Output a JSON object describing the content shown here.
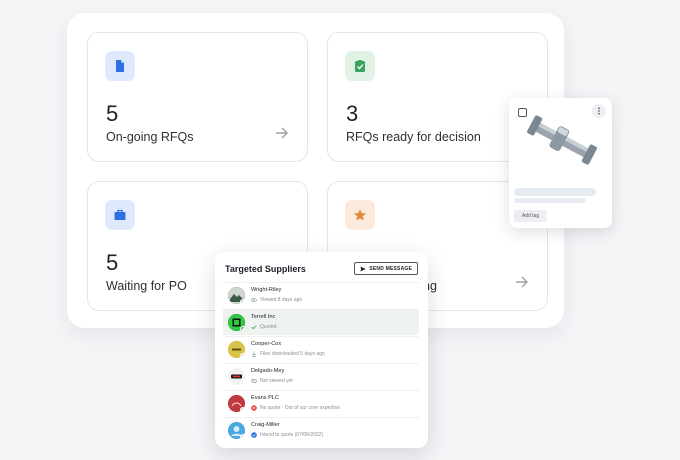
{
  "cards": [
    {
      "count": "5",
      "label": "On-going RFQs",
      "icon": "document-icon",
      "icon_color": "#2f6fe4",
      "icon_bg": "#dfe9fb"
    },
    {
      "count": "3",
      "label": "RFQs ready for decision",
      "icon": "clipboard-check-icon",
      "icon_color": "#3aa35f",
      "icon_bg": "#dff2e5"
    },
    {
      "count": "5",
      "label": "Waiting for PO",
      "icon": "briefcase-icon",
      "icon_color": "#2f6fe4",
      "icon_bg": "#dfe9fb"
    },
    {
      "count": "",
      "label": "ng",
      "icon": "star-icon",
      "icon_color": "#e08b43",
      "icon_bg": "#fbe9dc"
    }
  ],
  "product": {
    "add_tag": "Add tag"
  },
  "suppliers": {
    "title": "Targeted Suppliers",
    "send_label": "SEND MESSAGE",
    "rows": [
      {
        "name": "Wright-Riley",
        "status": "Viewed 8 days ago"
      },
      {
        "name": "Terrell Inc",
        "status": "Quoted"
      },
      {
        "name": "Cooper-Cox",
        "status": "Files downloaded 5 days ago"
      },
      {
        "name": "Delgado-Mey",
        "status": "Not viewed yet"
      },
      {
        "name": "Evans PLC",
        "status": "No quote · Out of our core expertise"
      },
      {
        "name": "Craig-Miller",
        "status": "Intend to quote (07/06/2022)"
      }
    ]
  }
}
